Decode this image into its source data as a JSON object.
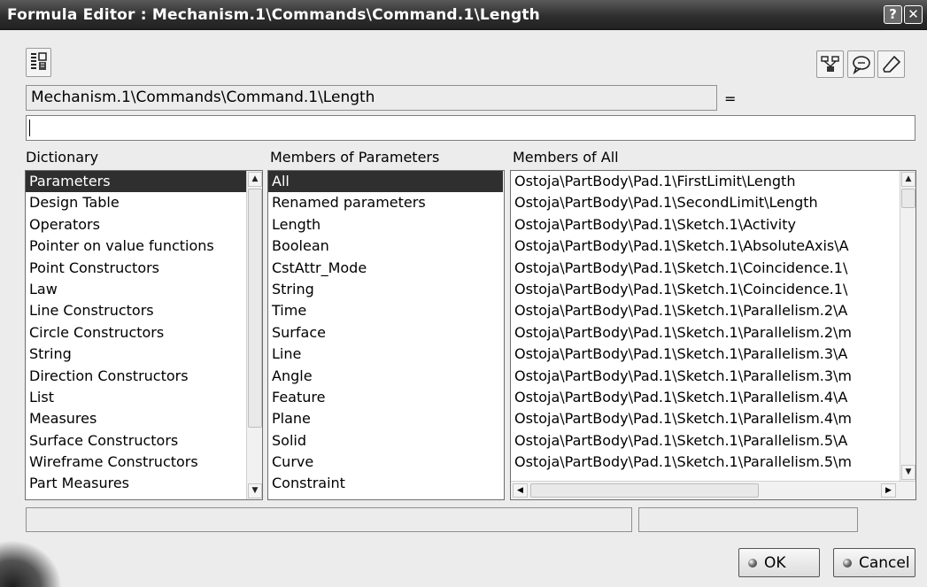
{
  "window": {
    "title": "Formula Editor : Mechanism.1\\Commands\\Command.1\\Length",
    "help_glyph": "?",
    "close_glyph": "✕"
  },
  "toolbar": {
    "left_icon": "formula-tree-icon",
    "right_icons": [
      "parameter-link-icon",
      "comment-icon",
      "eraser-icon"
    ]
  },
  "path_field": {
    "value": "Mechanism.1\\Commands\\Command.1\\Length",
    "equals_label": "="
  },
  "formula_input": {
    "value": ""
  },
  "dictionary": {
    "header": "Dictionary",
    "items": [
      "Parameters",
      "Design Table",
      "Operators",
      "Pointer on value functions",
      "Point Constructors",
      "Law",
      "Line Constructors",
      "Circle Constructors",
      "String",
      "Direction Constructors",
      "List",
      "Measures",
      "Surface Constructors",
      "Wireframe Constructors",
      "Part Measures"
    ],
    "selected": "Parameters"
  },
  "members_of_parameters": {
    "header": "Members of Parameters",
    "items": [
      "All",
      "Renamed parameters",
      "Length",
      "Boolean",
      "CstAttr_Mode",
      "String",
      "Time",
      "Surface",
      "Line",
      "Angle",
      "Feature",
      "Plane",
      "Solid",
      "Curve",
      "Constraint"
    ],
    "selected": "All"
  },
  "members_of_all": {
    "header": "Members of All",
    "items": [
      "Ostoja\\PartBody\\Pad.1\\FirstLimit\\Length",
      "Ostoja\\PartBody\\Pad.1\\SecondLimit\\Length",
      "Ostoja\\PartBody\\Pad.1\\Sketch.1\\Activity",
      "Ostoja\\PartBody\\Pad.1\\Sketch.1\\AbsoluteAxis\\A",
      "Ostoja\\PartBody\\Pad.1\\Sketch.1\\Coincidence.1\\",
      "Ostoja\\PartBody\\Pad.1\\Sketch.1\\Coincidence.1\\",
      "Ostoja\\PartBody\\Pad.1\\Sketch.1\\Parallelism.2\\A",
      "Ostoja\\PartBody\\Pad.1\\Sketch.1\\Parallelism.2\\m",
      "Ostoja\\PartBody\\Pad.1\\Sketch.1\\Parallelism.3\\A",
      "Ostoja\\PartBody\\Pad.1\\Sketch.1\\Parallelism.3\\m",
      "Ostoja\\PartBody\\Pad.1\\Sketch.1\\Parallelism.4\\A",
      "Ostoja\\PartBody\\Pad.1\\Sketch.1\\Parallelism.4\\m",
      "Ostoja\\PartBody\\Pad.1\\Sketch.1\\Parallelism.5\\A",
      "Ostoja\\PartBody\\Pad.1\\Sketch.1\\Parallelism.5\\m"
    ]
  },
  "status": {
    "left": "",
    "right": ""
  },
  "buttons": {
    "ok_label": "OK",
    "cancel_label": "Cancel"
  },
  "colors": {
    "titlebar": "#2e2e2e",
    "selection": "#2f2f2f",
    "window_bg": "#ececec"
  }
}
